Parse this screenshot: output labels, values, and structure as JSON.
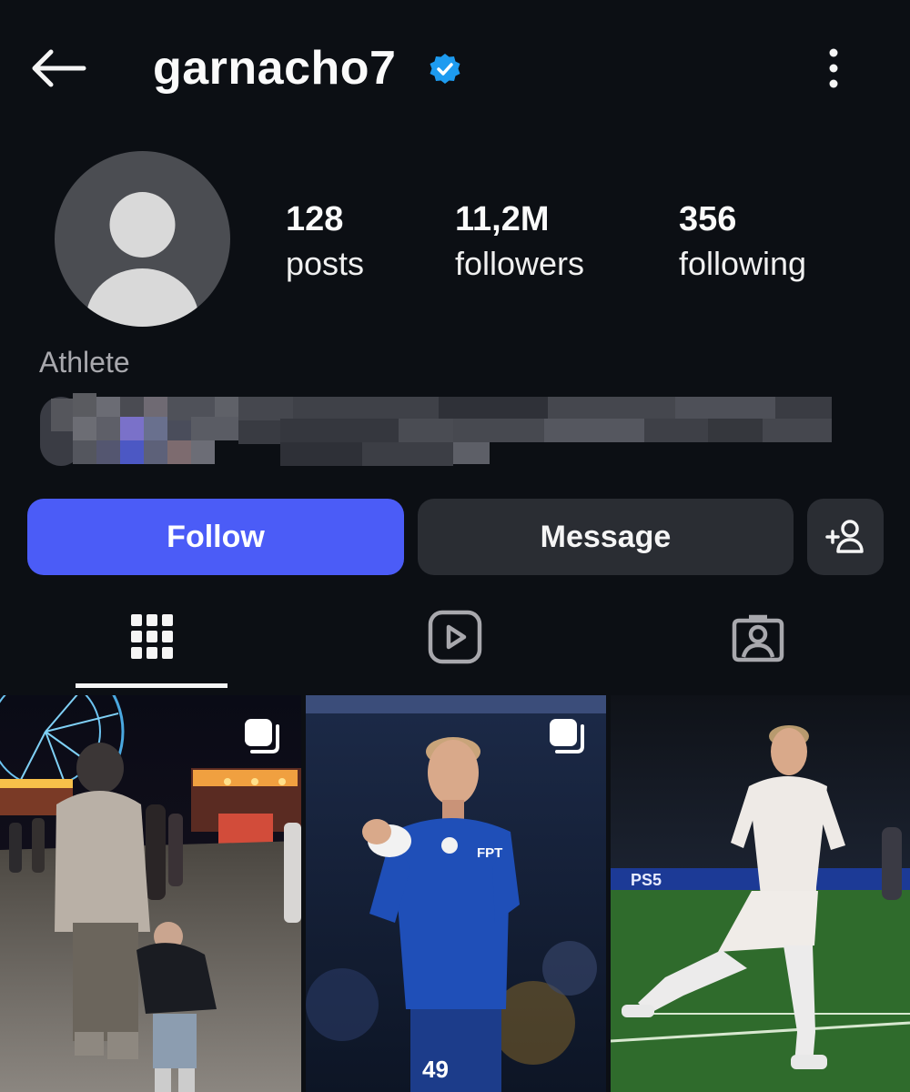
{
  "header": {
    "username": "garnacho7",
    "back_icon": "arrow-left-icon",
    "verified_icon": "verified-badge-icon",
    "more_icon": "more-vertical-icon"
  },
  "profile": {
    "avatar_icon": "default-avatar-icon",
    "stats": {
      "posts": {
        "value": "128",
        "label": "posts"
      },
      "followers": {
        "value": "11,2M",
        "label": "followers"
      },
      "following": {
        "value": "356",
        "label": "following"
      }
    },
    "category": "Athlete"
  },
  "actions": {
    "follow_label": "Follow",
    "message_label": "Message",
    "add_user_icon": "add-person-icon"
  },
  "tabs": [
    {
      "name": "posts-grid",
      "icon": "grid-icon",
      "active": true
    },
    {
      "name": "reels",
      "icon": "reels-play-icon",
      "active": false
    },
    {
      "name": "tagged",
      "icon": "tagged-user-icon",
      "active": false
    }
  ],
  "posts": [
    {
      "icon": "carousel-icon",
      "overlay_text": ""
    },
    {
      "icon": "carousel-icon",
      "overlay_text": "FPT"
    },
    {
      "icon": "",
      "overlay_text": "PS5"
    }
  ],
  "colors": {
    "background": "#0c0f14",
    "follow_button": "#4b5cf7",
    "secondary_button": "#2a2d33",
    "verified_blue": "#1d9bf0",
    "category_text": "#a8a8ad"
  }
}
